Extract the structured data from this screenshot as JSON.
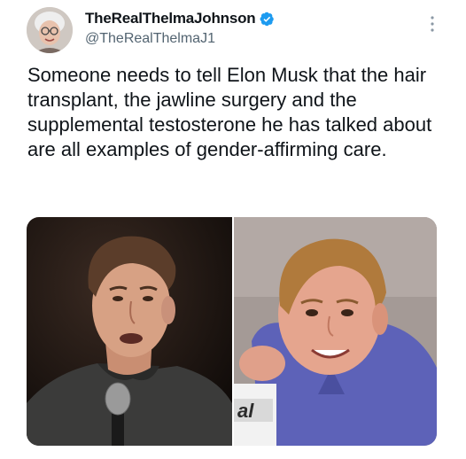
{
  "author": {
    "display_name": "TheRealThelmaJohnson",
    "handle": "@TheRealThelmaJ1",
    "verified": true,
    "verified_color": "#1d9bf0"
  },
  "tweet": {
    "text": "Someone needs to tell Elon Musk that the hair transplant, the jawline surgery and the supplemental testosterone he has talked about are all examples of gender-affirming care."
  },
  "media": {
    "sign_text": "al"
  },
  "icons": {
    "more": "more-vertical-icon",
    "verified": "verified-badge-icon"
  }
}
